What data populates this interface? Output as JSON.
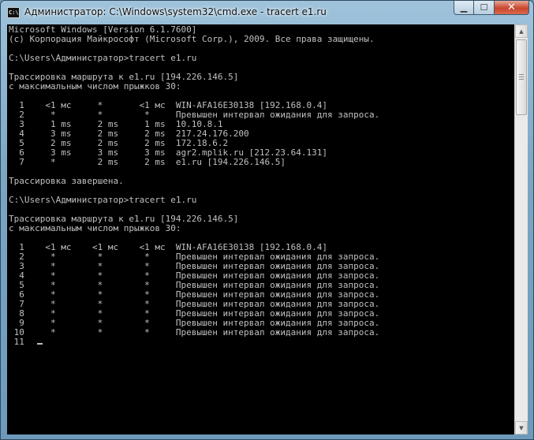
{
  "window": {
    "title": "Администратор: C:\\Windows\\system32\\cmd.exe - tracert  e1.ru",
    "icon_label": "C:\\",
    "minimize_glyph": "▁",
    "maximize_glyph": "☐",
    "close_glyph": "✕"
  },
  "console": {
    "lines": [
      "Microsoft Windows [Version 6.1.7600]",
      "(c) Корпорация Майкрософт (Microsoft Corp.), 2009. Все права защищены.",
      "",
      "C:\\Users\\Администратор>tracert e1.ru",
      "",
      "Трассировка маршрута к e1.ru [194.226.146.5]",
      "с максимальным числом прыжков 30:",
      "",
      "  1    <1 мс     *       <1 мс  WIN-AFA16E30138 [192.168.0.4]",
      "  2     *        *        *     Превышен интервал ожидания для запроса.",
      "  3     1 ms     2 ms     1 ms  10.10.8.1",
      "  4     3 ms     2 ms     2 ms  217.24.176.200",
      "  5     2 ms     2 ms     2 ms  172.18.6.2",
      "  6     3 ms     3 ms     3 ms  agr2.mplik.ru [212.23.64.131]",
      "  7     *        2 ms     2 ms  e1.ru [194.226.146.5]",
      "",
      "Трассировка завершена.",
      "",
      "C:\\Users\\Администратор>tracert e1.ru",
      "",
      "Трассировка маршрута к e1.ru [194.226.146.5]",
      "с максимальным числом прыжков 30:",
      "",
      "  1    <1 мс    <1 мс    <1 мс  WIN-AFA16E30138 [192.168.0.4]",
      "  2     *        *        *     Превышен интервал ожидания для запроса.",
      "  3     *        *        *     Превышен интервал ожидания для запроса.",
      "  4     *        *        *     Превышен интервал ожидания для запроса.",
      "  5     *        *        *     Превышен интервал ожидания для запроса.",
      "  6     *        *        *     Превышен интервал ожидания для запроса.",
      "  7     *        *        *     Превышен интервал ожидания для запроса.",
      "  8     *        *        *     Превышен интервал ожидания для запроса.",
      "  9     *        *        *     Превышен интервал ожидания для запроса.",
      " 10     *        *        *     Превышен интервал ожидания для запроса.",
      " 11  "
    ],
    "colors": {
      "background": "#000000",
      "text": "#c0c0c0"
    }
  },
  "scrollbar": {
    "up_glyph": "▲",
    "down_glyph": "▼"
  }
}
